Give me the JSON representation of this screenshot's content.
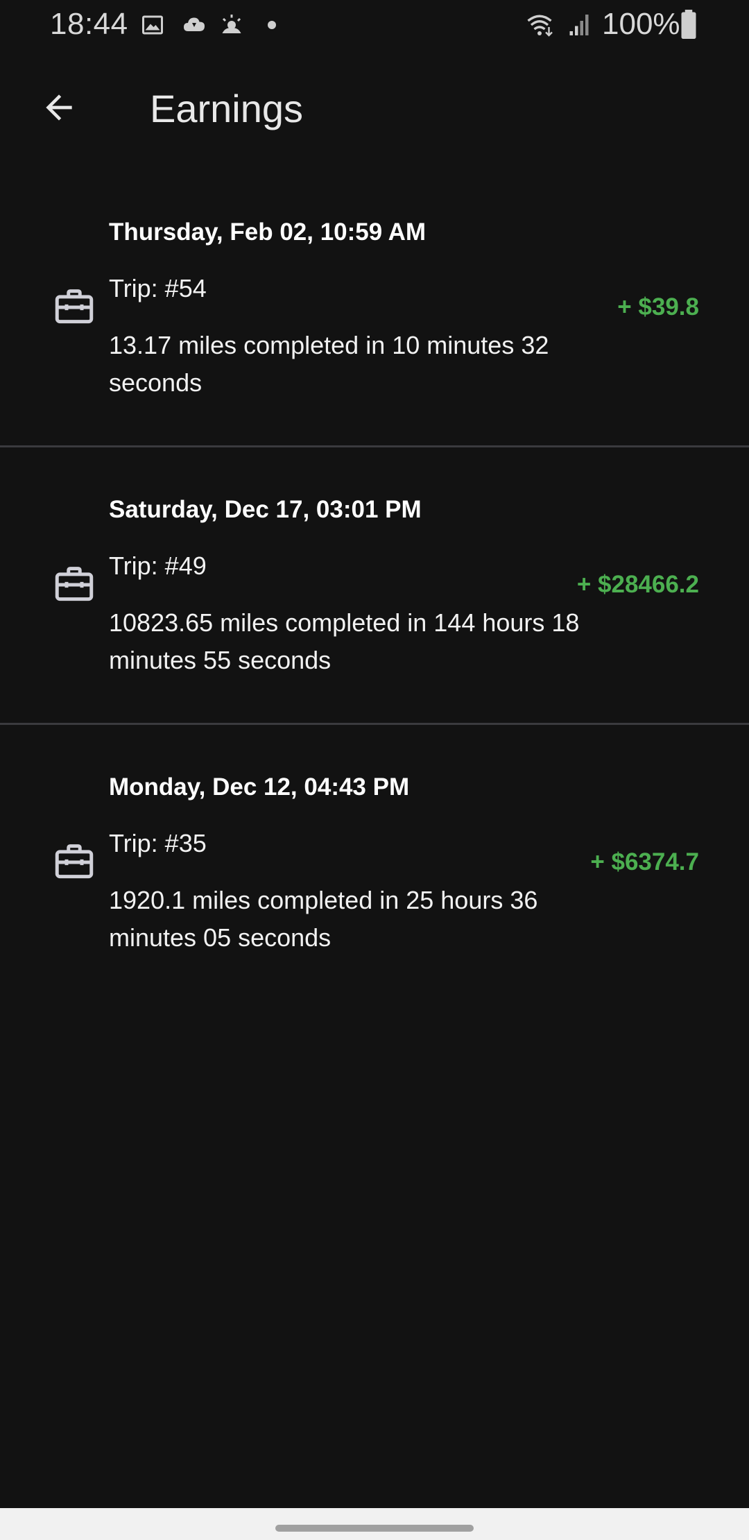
{
  "status_bar": {
    "time": "18:44",
    "battery": "100%",
    "icons": [
      "image-icon",
      "cloud-icon",
      "weather-icon",
      "dot-icon",
      "wifi-icon",
      "signal-icon",
      "battery-icon"
    ]
  },
  "app_bar": {
    "title": "Earnings",
    "back_icon": "arrow-back-icon"
  },
  "earnings": [
    {
      "date": "Thursday, Feb 02, 10:59 AM",
      "trip": "Trip: #54",
      "description": "13.17 miles completed in 10 minutes 32 seconds",
      "amount": "+ $39.8",
      "icon": "briefcase-icon"
    },
    {
      "date": "Saturday, Dec 17, 03:01 PM",
      "trip": "Trip: #49",
      "description": "10823.65 miles completed in 144 hours 18 minutes 55 seconds",
      "amount": "+ $28466.2",
      "icon": "briefcase-icon"
    },
    {
      "date": "Monday, Dec 12, 04:43 PM",
      "trip": "Trip: #35",
      "description": "1920.1 miles completed in 25 hours 36 minutes 05 seconds",
      "amount": "+ $6374.7",
      "icon": "briefcase-icon"
    }
  ],
  "colors": {
    "background": "#121212",
    "amount": "#4caf50",
    "divider": "#3a3a3e"
  }
}
